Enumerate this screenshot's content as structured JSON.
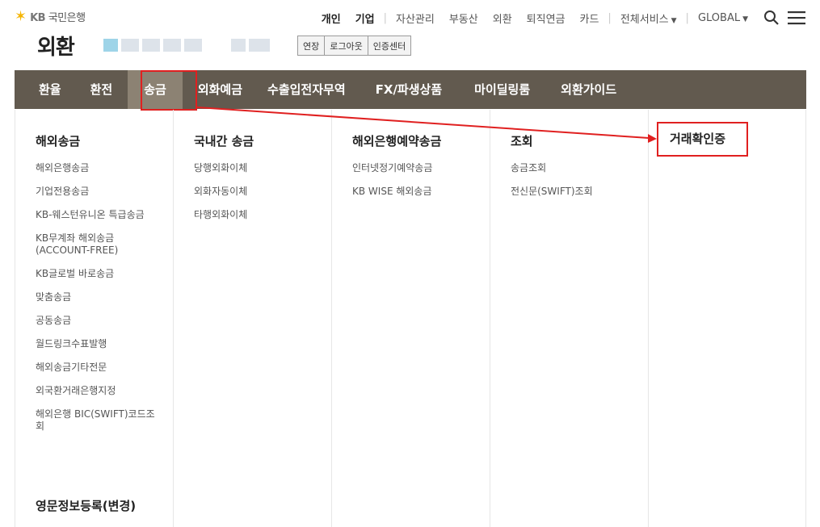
{
  "logo": {
    "brand": "KB",
    "name": "국민은행"
  },
  "topnav": {
    "items": [
      "개인",
      "기업",
      "자산관리",
      "부동산",
      "외환",
      "퇴직연금",
      "카드",
      "전체서비스",
      "GLOBAL"
    ]
  },
  "title": {
    "page": "외환"
  },
  "session_buttons": [
    "연장",
    "로그아웃",
    "인증센터"
  ],
  "mainnav": {
    "tabs": [
      "환율",
      "환전",
      "송금",
      "외화예금",
      "수출입전자무역",
      "FX/파생상품",
      "마이딜링룸",
      "외환가이드"
    ],
    "active": "송금"
  },
  "menu": {
    "col1": {
      "head": "해외송금",
      "items": [
        "해외은행송금",
        "기업전용송금",
        "KB-웨스턴유니온 특급송금",
        "KB무계좌 해외송금(ACCOUNT-FREE)",
        "KB글로벌 바로송금",
        "맞춤송금",
        "공동송금",
        "월드링크수표발행",
        "해외송금기타전문",
        "외국환거래은행지정",
        "해외은행 BIC(SWIFT)코드조회"
      ],
      "bottom_head": "영문정보등록(변경)"
    },
    "col2": {
      "head": "국내간 송금",
      "items": [
        "당행외화이체",
        "외화자동이체",
        "타행외화이체"
      ]
    },
    "col3": {
      "head": "해외은행예약송금",
      "items": [
        "인터넷정기예약송금",
        "KB WISE 해외송금"
      ]
    },
    "col4": {
      "head": "조회",
      "items": [
        "송금조회",
        "전신문(SWIFT)조회"
      ]
    },
    "col5": {
      "head": "거래확인증"
    }
  },
  "colors": {
    "nav_bg": "#625a4f",
    "nav_active": "#8c8273",
    "highlight": "#e02020",
    "logo_star": "#f5b400"
  }
}
